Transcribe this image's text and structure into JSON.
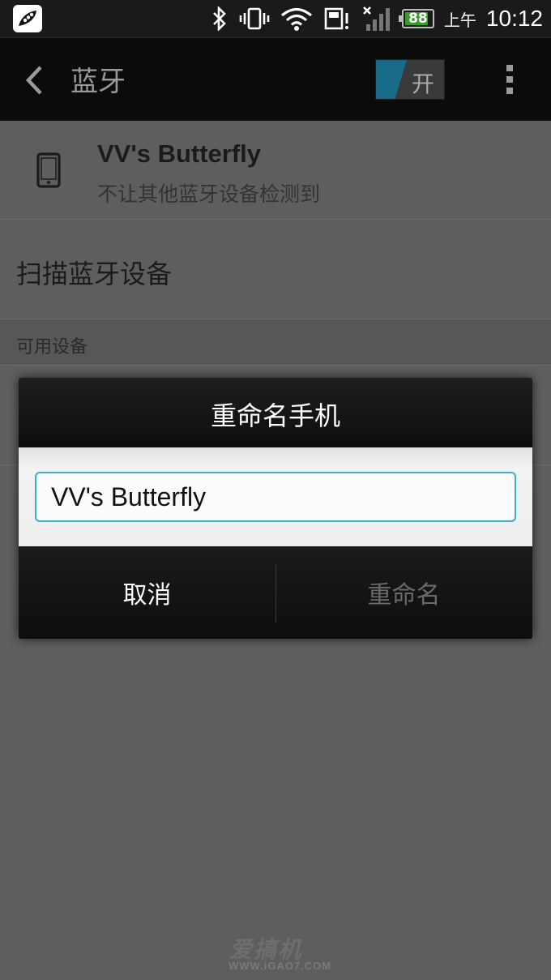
{
  "status_bar": {
    "battery_level": "88",
    "ampm": "上午",
    "time": "10:12",
    "icons": [
      "app-notification-icon",
      "bluetooth-icon",
      "vibrate-icon",
      "wifi-icon",
      "sd-card-icon",
      "no-signal-icon",
      "battery-icon"
    ]
  },
  "action_bar": {
    "title": "蓝牙",
    "toggle_label": "开",
    "toggle_on": true
  },
  "device": {
    "name": "VV's Butterfly",
    "subtitle": "不让其他蓝牙设备检测到"
  },
  "scan": {
    "label": "扫描蓝牙设备"
  },
  "available": {
    "header": "可用设备"
  },
  "dialog": {
    "title": "重命名手机",
    "input_value": "VV's Butterfly",
    "cancel_label": "取消",
    "rename_label": "重命名"
  },
  "watermark": {
    "logo": "爱搞机",
    "url": "WWW.iGAO7.COM"
  },
  "colors": {
    "accent": "#3ab0d0",
    "toggle_on": "#1a6b8a",
    "battery": "#3a9b2a"
  }
}
